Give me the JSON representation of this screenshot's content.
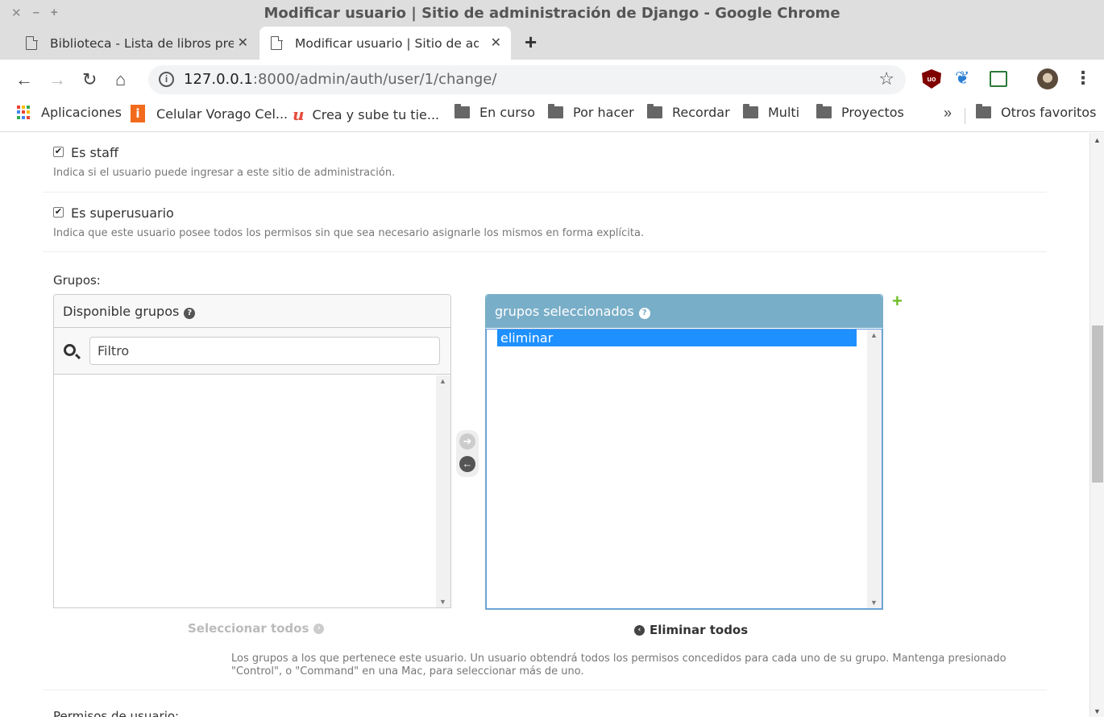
{
  "window": {
    "title": "Modificar usuario | Sitio de administración de Django - Google Chrome",
    "controls": [
      "✕",
      "–",
      "+"
    ]
  },
  "tabs": [
    {
      "label": "Biblioteca - Lista de libros prestados"
    },
    {
      "label": "Modificar usuario | Sitio de administración de Django"
    }
  ],
  "toolbar": {
    "url_host": "127.0.0.1",
    "url_rest": ":8000/admin/auth/user/1/change/"
  },
  "bookmarks": {
    "apps": "Aplicaciones",
    "items": [
      "Celular Vorago Cel...",
      "Crea y sube tu tie...",
      "En curso",
      "Por hacer",
      "Recordar",
      "Multi",
      "Proyectos"
    ],
    "more": "»",
    "other": "Otros favoritos"
  },
  "form": {
    "staff": {
      "label": "Es staff",
      "help": "Indica si el usuario puede ingresar a este sitio de administración.",
      "checked": true
    },
    "superuser": {
      "label": "Es superusuario",
      "help": "Indica que este usuario posee todos los permisos sin que sea necesario asignarle los mismos en forma explícita.",
      "checked": true
    },
    "groups": {
      "label": "Grupos:",
      "available_title": "Disponible grupos",
      "filter_placeholder": "Filtro",
      "chosen_title": "grupos seleccionados",
      "chosen_items": [
        "eliminar"
      ],
      "select_all": "Seleccionar todos",
      "remove_all": "Eliminar todos",
      "help": "Los grupos a los que pertenece este usuario. Un usuario obtendrá todos los permisos concedidos para cada uno de su grupo. Mantenga presionado \"Control\", o \"Command\" en una Mac, para seleccionar más de uno."
    },
    "next_label": "Permisos de usuario:"
  }
}
